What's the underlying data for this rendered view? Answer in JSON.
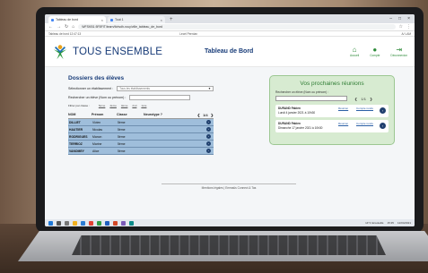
{
  "browser": {
    "tabs": [
      {
        "label": "Tableau de bord"
      },
      {
        "label": "Tout 1"
      }
    ],
    "url": "WFSKB1:5F8FIT/learn/tb/wdh-rouy/ville_tableau_de_bord",
    "bookmarks": {
      "left": "Tableau de bord  12:47:13",
      "center": "Lecel Perrdan",
      "right": "A/ LAM"
    }
  },
  "header": {
    "logo_text": "TOUS ENSEMBLE",
    "page_title": "Tableau de Bord",
    "nav": [
      {
        "label": "Accueil",
        "icon": "home-icon"
      },
      {
        "label": "Compte",
        "icon": "user-icon"
      },
      {
        "label": "Déconnexion",
        "icon": "logout-icon"
      }
    ]
  },
  "dossiers": {
    "title": "Dossiers des élèves",
    "school_label": "Sélectionner un établissement :",
    "school_placeholder": "Tous les établissements",
    "search_label": "Rechercher un élève (Nom ou prénom) :",
    "filter_label": "Filtrer par classe :",
    "filters": [
      "5ème",
      "4ème",
      "3ème",
      "2nd",
      "1ère"
    ],
    "columns": {
      "nom": "NOM",
      "prenom": "Prénom",
      "classe": "Classe",
      "neurotype": "Neurotype ?"
    },
    "pager": {
      "prev": "❮",
      "page": "1/4",
      "next": "❯"
    },
    "rows": [
      {
        "nom": "DILLIET",
        "prenom": "Vivien",
        "classe": "5ème",
        "neurotype": ""
      },
      {
        "nom": "HAUTIER",
        "prenom": "Nicolas",
        "classe": "5ème",
        "neurotype": ""
      },
      {
        "nom": "RODRIGUES",
        "prenom": "Manon",
        "classe": "5ème",
        "neurotype": ""
      },
      {
        "nom": "TERRIOZ",
        "prenom": "Marine",
        "classe": "5ème",
        "neurotype": ""
      },
      {
        "nom": "VANOMEY",
        "prenom": "Alice",
        "classe": "5ème",
        "neurotype": ""
      }
    ]
  },
  "meetings": {
    "title": "Vos prochaines réunions",
    "search_label": "Rechercher un élève (Nom ou prénom) :",
    "pager": {
      "prev": "❮",
      "page": "1/1",
      "next": "❯"
    },
    "items": [
      {
        "name": "DURAND Fabien",
        "date": "Lundi 4 janvier 2021 à 10h30",
        "link1": "Réunion",
        "link2": "Compte rendu"
      },
      {
        "name": "DURAND Fabien",
        "date": "Dimanche 17 janvier 2021 à 10h30",
        "link1": "Réunion",
        "link2": "Compte rendu"
      }
    ]
  },
  "footer": {
    "text": "Mentions légales  |  Emmaüs Connect & Tas"
  },
  "taskbar": {
    "weather": "14°C Ensoleillé",
    "time": "15:35",
    "date": "12/04/2021"
  }
}
